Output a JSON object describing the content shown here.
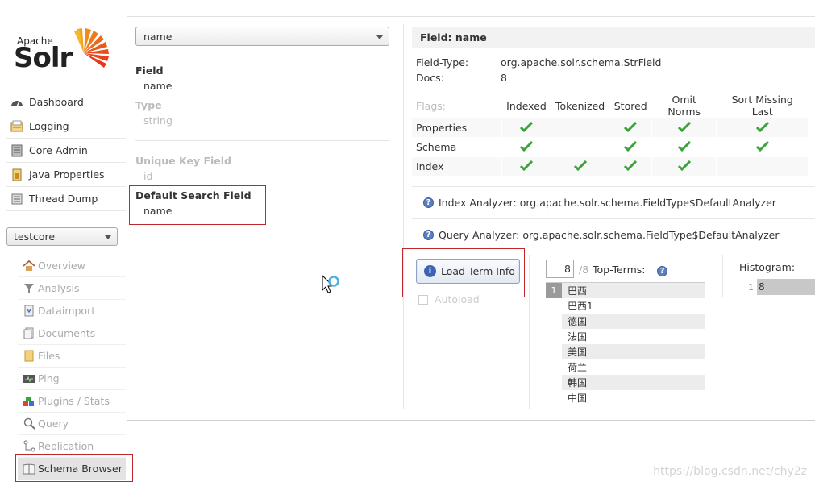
{
  "logo": {
    "top": "Apache",
    "main": "Solr"
  },
  "nav": [
    {
      "label": "Dashboard",
      "icon": "dashboard-icon"
    },
    {
      "label": "Logging",
      "icon": "logging-icon"
    },
    {
      "label": "Core Admin",
      "icon": "core-admin-icon"
    },
    {
      "label": "Java Properties",
      "icon": "java-properties-icon"
    },
    {
      "label": "Thread Dump",
      "icon": "thread-dump-icon"
    }
  ],
  "core_selector": {
    "value": "testcore"
  },
  "core_menu": [
    {
      "label": "Overview",
      "icon": "home-icon"
    },
    {
      "label": "Analysis",
      "icon": "filter-icon"
    },
    {
      "label": "Dataimport",
      "icon": "dataimport-icon"
    },
    {
      "label": "Documents",
      "icon": "documents-icon"
    },
    {
      "label": "Files",
      "icon": "files-icon"
    },
    {
      "label": "Ping",
      "icon": "ping-icon"
    },
    {
      "label": "Plugins / Stats",
      "icon": "plugins-icon"
    },
    {
      "label": "Query",
      "icon": "query-icon"
    },
    {
      "label": "Replication",
      "icon": "replication-icon"
    },
    {
      "label": "Schema Browser",
      "icon": "schema-browser-icon",
      "active": true
    }
  ],
  "schema": {
    "field_select": "name",
    "field_label": "Field",
    "field_value": "name",
    "type_label": "Type",
    "type_value": "string",
    "unique_key_label": "Unique Key Field",
    "unique_key_value": "id",
    "default_search_label": "Default Search Field",
    "default_search_value": "name"
  },
  "field_info": {
    "title": "Field: name",
    "field_type_label": "Field-Type:",
    "field_type_value": "org.apache.solr.schema.StrField",
    "docs_label": "Docs:",
    "docs_value": "8",
    "flags_label": "Flags:",
    "flag_columns": [
      "Indexed",
      "Tokenized",
      "Stored",
      "Omit Norms",
      "Sort Missing Last"
    ],
    "flag_rows": [
      {
        "label": "Properties",
        "checks": [
          true,
          false,
          true,
          true,
          true
        ]
      },
      {
        "label": "Schema",
        "checks": [
          true,
          false,
          true,
          true,
          true
        ]
      },
      {
        "label": "Index",
        "checks": [
          true,
          true,
          true,
          true,
          false
        ]
      }
    ],
    "index_analyzer": "Index Analyzer: org.apache.solr.schema.FieldType$DefaultAnalyzer",
    "query_analyzer": "Query Analyzer: org.apache.solr.schema.FieldType$DefaultAnalyzer"
  },
  "term_info": {
    "load_button": "Load Term Info",
    "autoload_label": "Autoload",
    "top_terms_input": "8",
    "top_terms_total": "/8",
    "top_terms_label": "Top-Terms:",
    "terms": [
      {
        "count": "1",
        "term": "巴西"
      },
      {
        "count": "",
        "term": "巴西1"
      },
      {
        "count": "",
        "term": "德国"
      },
      {
        "count": "",
        "term": "法国"
      },
      {
        "count": "",
        "term": "美国"
      },
      {
        "count": "",
        "term": "荷兰"
      },
      {
        "count": "",
        "term": "韩国"
      },
      {
        "count": "",
        "term": "中国"
      }
    ],
    "histogram_label": "Histogram:",
    "histogram_key": "1",
    "histogram_value": "8"
  },
  "watermark": "https://blog.csdn.net/chy2z",
  "colors": {
    "check": "#3aa43a",
    "highlight_box": "#c0262b",
    "info_icon": "#3d63b4"
  }
}
